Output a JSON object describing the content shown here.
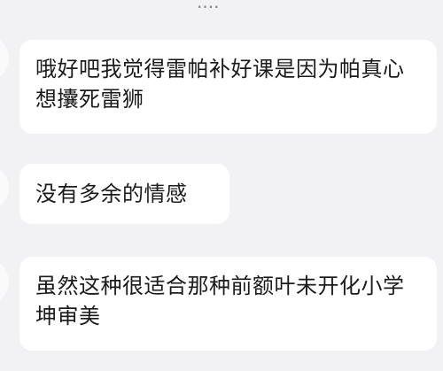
{
  "header": {
    "fragment": "...."
  },
  "messages": [
    {
      "text": "哦好吧我觉得雷帕补好课是因为帕真心想攮死雷狮"
    },
    {
      "text": "没有多余的情感"
    },
    {
      "text": "虽然这种很适合那种前额叶未开化小学坤审美"
    }
  ]
}
